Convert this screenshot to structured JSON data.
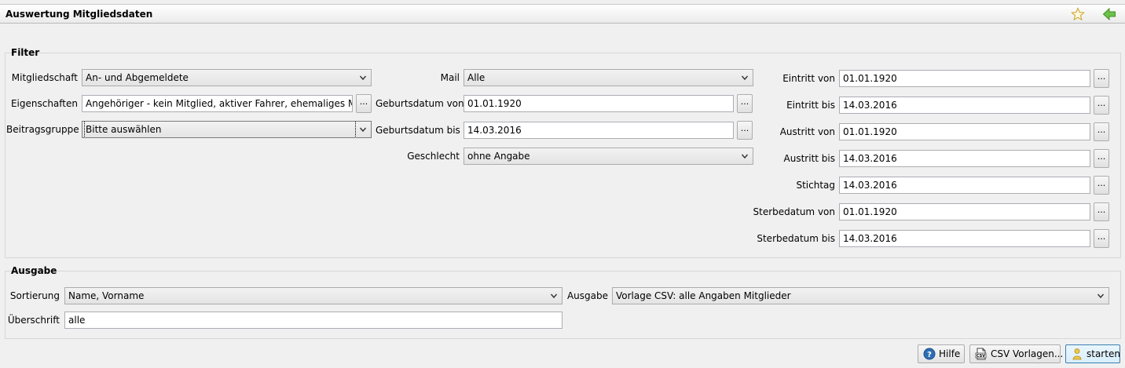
{
  "window": {
    "title": "Auswertung Mitgliedsdaten"
  },
  "filter": {
    "title": "Filter",
    "mitgliedschaft": {
      "label": "Mitgliedschaft",
      "value": "An- und Abgemeldete"
    },
    "eigenschaften": {
      "label": "Eigenschaften",
      "value": "Angehöriger - kein Mitglied, aktiver Fahrer, ehemaliges Mitglied"
    },
    "beitragsgruppe": {
      "label": "Beitragsgruppe",
      "value": "Bitte auswählen"
    },
    "mail": {
      "label": "Mail",
      "value": "Alle"
    },
    "geburtsdatum_von": {
      "label": "Geburtsdatum von",
      "value": "01.01.1920"
    },
    "geburtsdatum_bis": {
      "label": "Geburtsdatum bis",
      "value": "14.03.2016"
    },
    "geschlecht": {
      "label": "Geschlecht",
      "value": "ohne Angabe"
    },
    "eintritt_von": {
      "label": "Eintritt von",
      "value": "01.01.1920"
    },
    "eintritt_bis": {
      "label": "Eintritt bis",
      "value": "14.03.2016"
    },
    "austritt_von": {
      "label": "Austritt von",
      "value": "01.01.1920"
    },
    "austritt_bis": {
      "label": "Austritt bis",
      "value": "14.03.2016"
    },
    "stichtag": {
      "label": "Stichtag",
      "value": "14.03.2016"
    },
    "sterbedatum_von": {
      "label": "Sterbedatum von",
      "value": "01.01.1920"
    },
    "sterbedatum_bis": {
      "label": "Sterbedatum bis",
      "value": "14.03.2016"
    },
    "dots_label": "..."
  },
  "ausgabe": {
    "title": "Ausgabe",
    "sortierung": {
      "label": "Sortierung",
      "value": "Name, Vorname"
    },
    "ausgabe": {
      "label": "Ausgabe",
      "value": "Vorlage CSV: alle Angaben Mitglieder"
    },
    "ueberschrift": {
      "label": "Überschrift",
      "value": "alle"
    }
  },
  "buttons": {
    "hilfe": "Hilfe",
    "csv_vorlagen": "CSV Vorlagen...",
    "starten": "starten"
  },
  "icons": {
    "star": "star-icon",
    "back": "back-arrow-icon",
    "help": "help-icon",
    "csv": "csv-file-icon",
    "start": "person-start-icon",
    "dropdown": "chevron-down-icon"
  },
  "colors": {
    "accent_green": "#5bb33e",
    "star_yellow": "#e8c34a",
    "help_blue": "#2d6db5"
  }
}
